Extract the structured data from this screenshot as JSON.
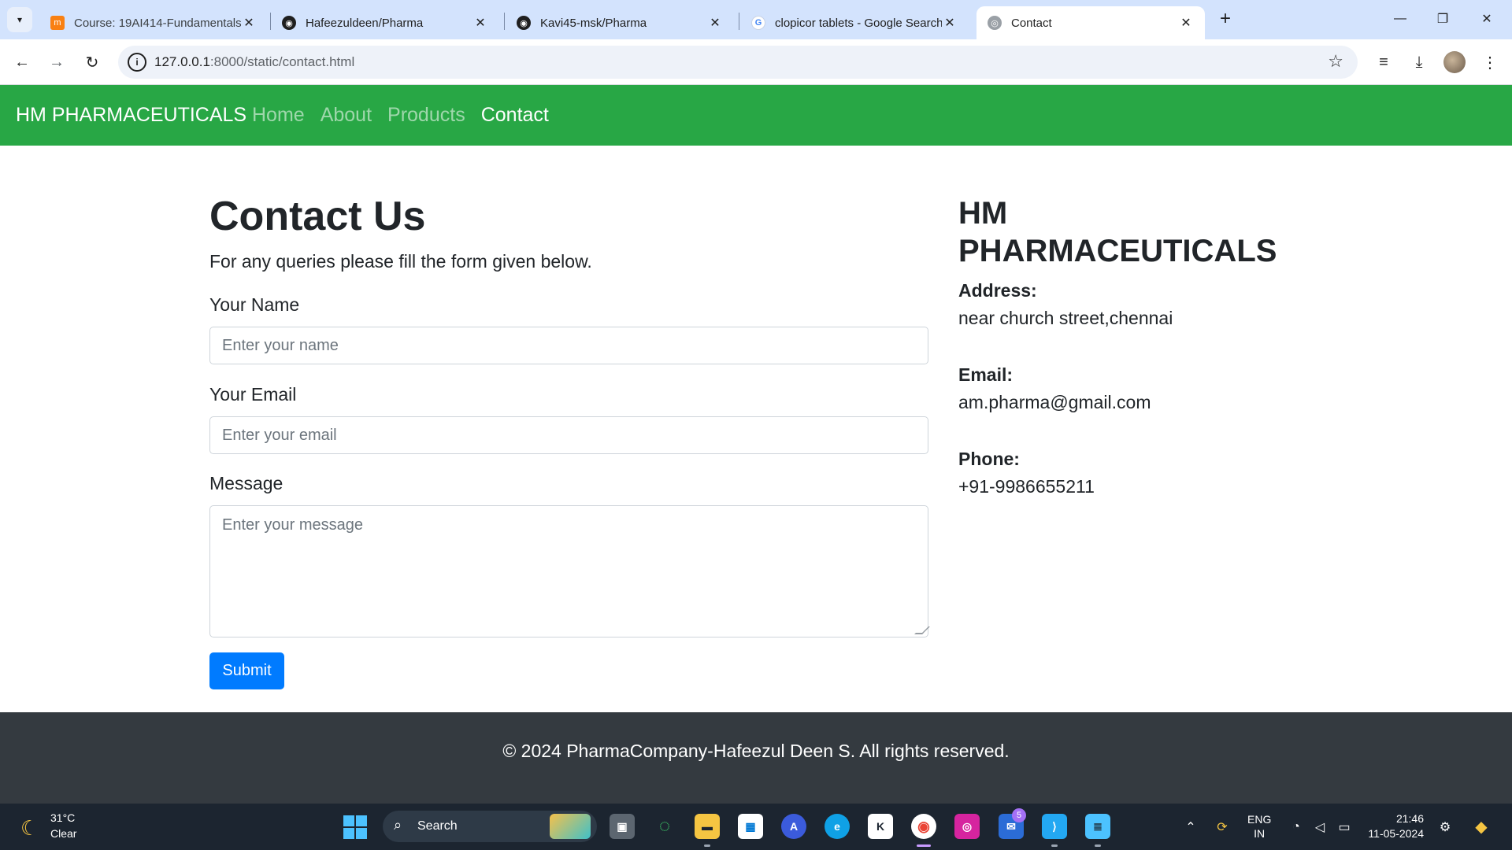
{
  "browser": {
    "tabs": [
      {
        "title": "Course: 19AI414-Fundamentals",
        "favicon": "moodle-icon"
      },
      {
        "title": "Hafeezuldeen/Pharma",
        "favicon": "github-icon"
      },
      {
        "title": "Kavi45-msk/Pharma",
        "favicon": "github-icon"
      },
      {
        "title": "clopicor tablets - Google Search",
        "favicon": "google-icon"
      },
      {
        "title": "Contact",
        "favicon": "globe-icon"
      }
    ],
    "url_host": "127.0.0.1",
    "url_rest": ":8000/static/contact.html"
  },
  "site": {
    "brand": "HM PHARMACEUTICALS",
    "nav": [
      "Home",
      "About",
      "Products",
      "Contact"
    ],
    "active_nav": "Contact",
    "nav_color": "#28a745"
  },
  "contact": {
    "heading": "Contact Us",
    "intro": "For any queries please fill the form given below.",
    "name_label": "Your Name",
    "name_placeholder": "Enter your name",
    "email_label": "Your Email",
    "email_placeholder": "Enter your email",
    "message_label": "Message",
    "message_placeholder": "Enter your message",
    "submit_label": "Submit",
    "submit_color": "#007bff"
  },
  "company": {
    "name": "HM PHARMACEUTICALS",
    "address_label": "Address:",
    "address": "near church street,chennai",
    "email_label": "Email:",
    "email": "am.pharma@gmail.com",
    "phone_label": "Phone:",
    "phone": "+91-9986655211"
  },
  "footer": {
    "text": "© 2024 PharmaCompany-Hafeezul Deen S. All rights reserved."
  },
  "taskbar": {
    "temperature": "31°C",
    "condition": "Clear",
    "search_label": "Search",
    "language_line1": "ENG",
    "language_line2": "IN",
    "time": "21:46",
    "date": "11-05-2024",
    "badge_count": "5"
  }
}
